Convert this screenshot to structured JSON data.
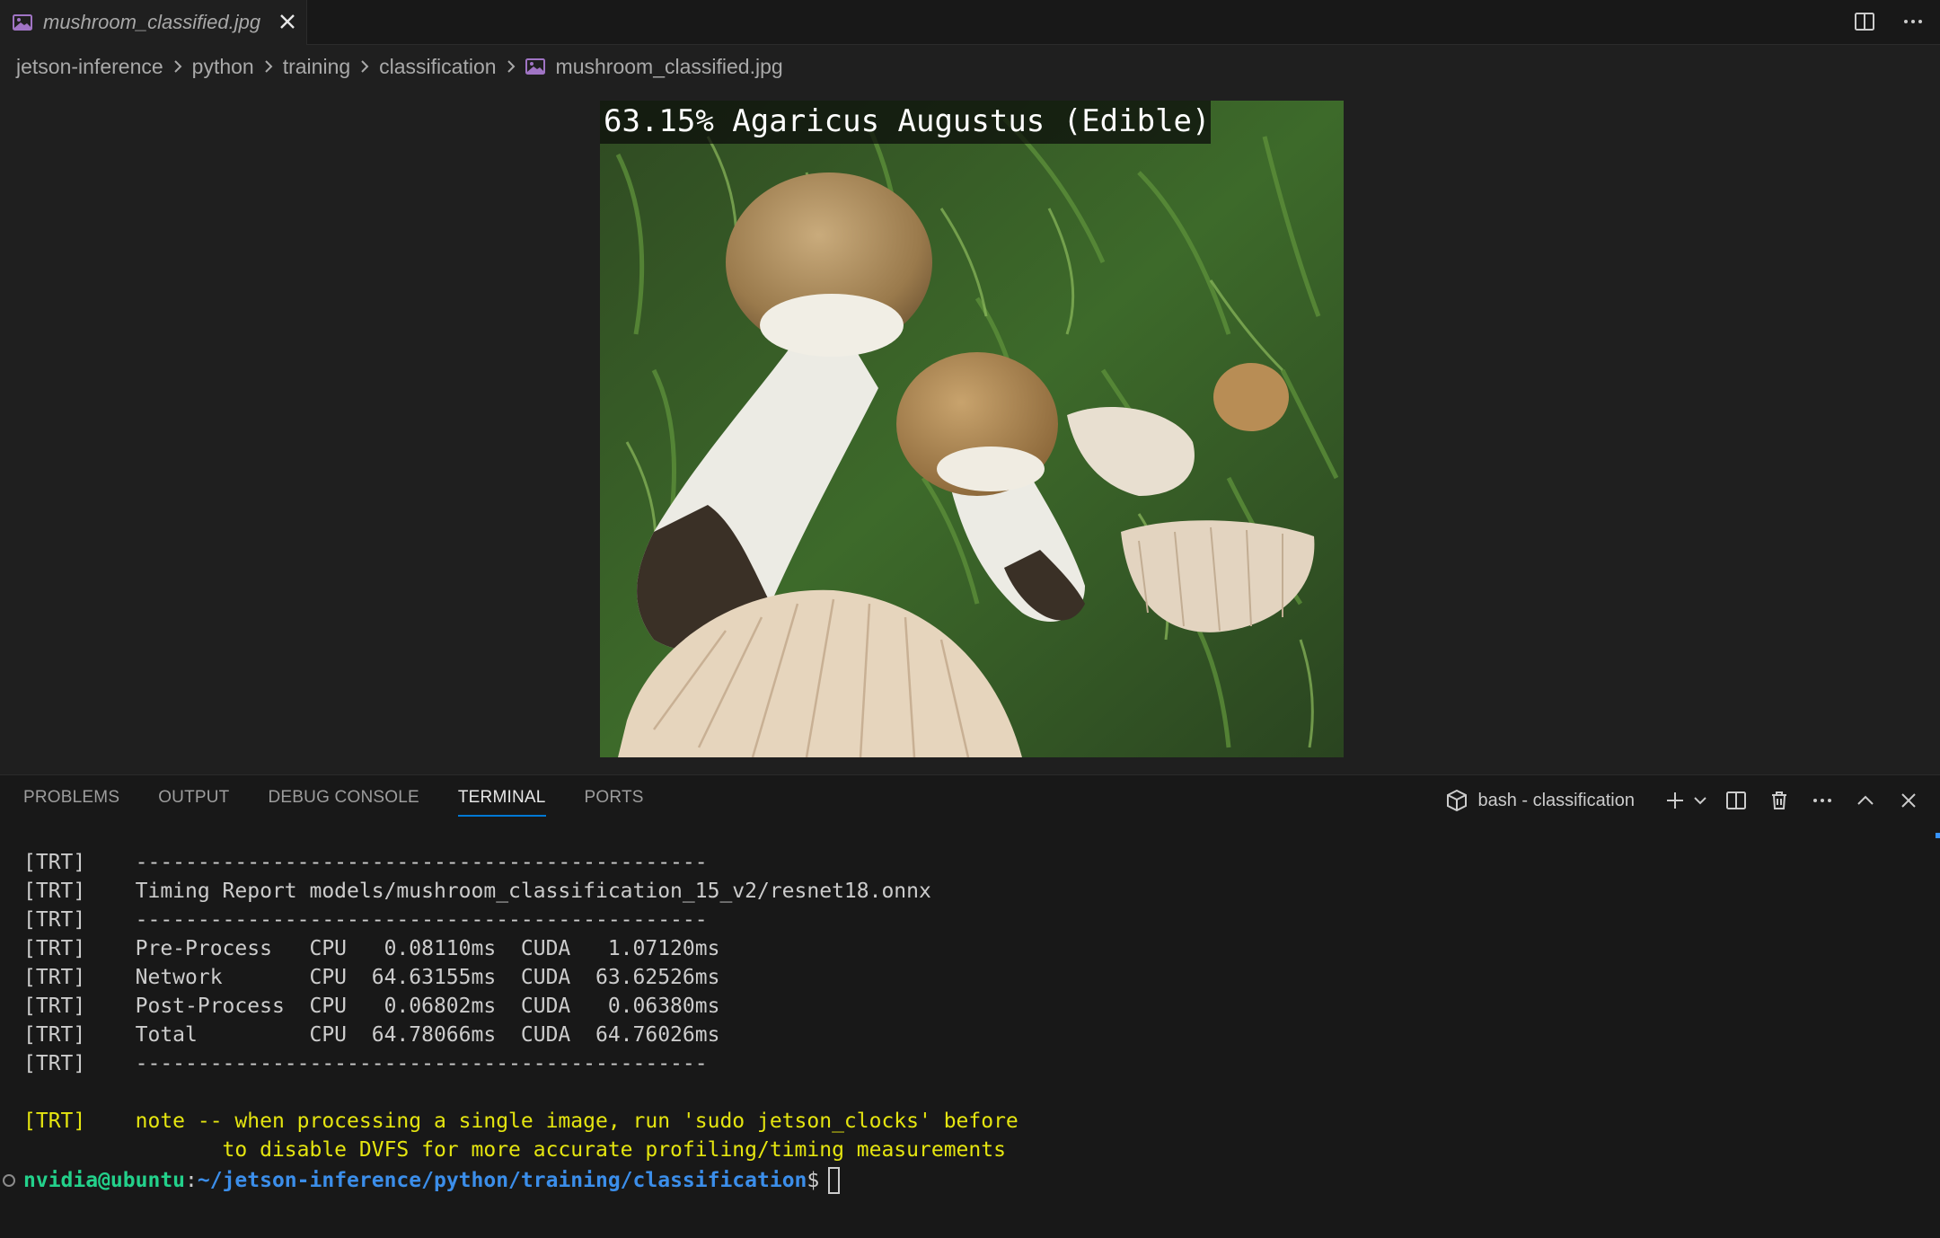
{
  "tabbar": {
    "tab_label": "mushroom_classified.jpg",
    "tab_icon": "image-file-icon",
    "actions": [
      "split-editor-icon",
      "more-actions-icon"
    ]
  },
  "breadcrumb": {
    "items": [
      "jetson-inference",
      "python",
      "training",
      "classification"
    ],
    "file": "mushroom_classified.jpg"
  },
  "preview": {
    "caption": "63.15% Agaricus Augustus (Edible)"
  },
  "panel": {
    "tabs": [
      "PROBLEMS",
      "OUTPUT",
      "DEBUG CONSOLE",
      "TERMINAL",
      "PORTS"
    ],
    "active_tab": "TERMINAL",
    "terminal_name": "bash - classification"
  },
  "terminal": {
    "lines": [
      "[TRT]    ----------------------------------------------",
      "[TRT]    Timing Report models/mushroom_classification_15_v2/resnet18.onnx",
      "[TRT]    ----------------------------------------------",
      "[TRT]    Pre-Process   CPU   0.08110ms  CUDA   1.07120ms",
      "[TRT]    Network       CPU  64.63155ms  CUDA  63.62526ms",
      "[TRT]    Post-Process  CPU   0.06802ms  CUDA   0.06380ms",
      "[TRT]    Total         CPU  64.78066ms  CUDA  64.76026ms",
      "[TRT]    ----------------------------------------------"
    ],
    "note_lines": [
      "[TRT]    note -- when processing a single image, run 'sudo jetson_clocks' before",
      "                to disable DVFS for more accurate profiling/timing measurements"
    ],
    "prompt": {
      "user": "nvidia@ubuntu",
      "separator": ":",
      "path": "~/jetson-inference/python/training/classification",
      "symbol": "$"
    }
  },
  "colors": {
    "accent": "#0078d4",
    "prompt_user": "#23d18b",
    "prompt_path": "#3b8eea",
    "note_text": "#e5e510"
  }
}
